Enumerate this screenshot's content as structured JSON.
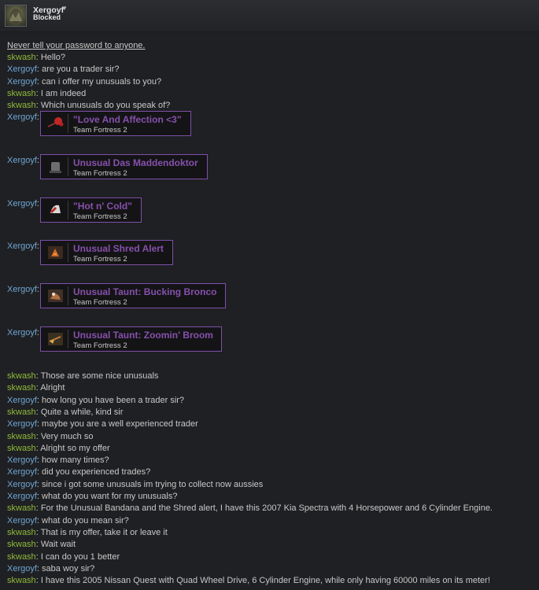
{
  "header": {
    "name": "Xergoyf",
    "status": "Blocked",
    "dropdown_icon": "▼"
  },
  "warning": "Never tell your password to anyone.",
  "accent_colors": {
    "skwash": "#8fb93b",
    "xergoyf": "#6fa6d3",
    "unusual": "#8650ac"
  },
  "messages_top": [
    {
      "sender": "skwash",
      "text": "Hello?"
    },
    {
      "sender": "Xergoyf",
      "text": "are you a trader sir?"
    },
    {
      "sender": "Xergoyf",
      "text": "can i offer my unusuals to you?"
    },
    {
      "sender": "skwash",
      "text": "I am indeed"
    },
    {
      "sender": "skwash",
      "text": "Which unusuals do you speak of?"
    }
  ],
  "items": [
    {
      "sender": "Xergoyf",
      "title": "\"Love And Affection <3\"",
      "game": "Team Fortress 2",
      "icon": "rose-icon"
    },
    {
      "sender": "Xergoyf",
      "title": "Unusual Das Maddendoktor",
      "game": "Team Fortress 2",
      "icon": "hat-icon"
    },
    {
      "sender": "Xergoyf",
      "title": "\"Hot n' Cold\"",
      "game": "Team Fortress 2",
      "icon": "helmet-icon"
    },
    {
      "sender": "Xergoyf",
      "title": "Unusual Shred Alert",
      "game": "Team Fortress 2",
      "icon": "guitar-icon"
    },
    {
      "sender": "Xergoyf",
      "title": "Unusual Taunt: Bucking Bronco",
      "game": "Team Fortress 2",
      "icon": "taunt-icon"
    },
    {
      "sender": "Xergoyf",
      "title": "Unusual Taunt: Zoomin' Broom",
      "game": "Team Fortress 2",
      "icon": "broom-icon"
    }
  ],
  "messages_bottom": [
    {
      "sender": "skwash",
      "text": "Those are some nice unusuals"
    },
    {
      "sender": "skwash",
      "text": "Alright"
    },
    {
      "sender": "Xergoyf",
      "text": "how long you have been a trader sir?"
    },
    {
      "sender": "skwash",
      "text": "Quite a while, kind sir"
    },
    {
      "sender": "Xergoyf",
      "text": "maybe you are a well experienced trader"
    },
    {
      "sender": "skwash",
      "text": "Very much so"
    },
    {
      "sender": "skwash",
      "text": "Alright so my offer"
    },
    {
      "sender": "Xergoyf",
      "text": "how many times?"
    },
    {
      "sender": "Xergoyf",
      "text": "did you experienced trades?"
    },
    {
      "sender": "Xergoyf",
      "text": "since i got some unusuals im trying to collect now aussies"
    },
    {
      "sender": "Xergoyf",
      "text": "what do you want for my unusuals?"
    },
    {
      "sender": "skwash",
      "text": "For the Unusual Bandana and the Shred alert, I have this 2007 Kia Spectra with 4 Horsepower and 6 Cylinder Engine."
    },
    {
      "sender": "Xergoyf",
      "text": "what do you mean sir?"
    },
    {
      "sender": "skwash",
      "text": "That is my offer, take it or leave it"
    },
    {
      "sender": "skwash",
      "text": "Wait wait"
    },
    {
      "sender": "skwash",
      "text": "I can do you 1 better"
    },
    {
      "sender": "Xergoyf",
      "text": "saba woy sir?"
    },
    {
      "sender": "skwash",
      "text": "I have this 2005 Nissan Quest with Quad Wheel Drive, 6 Cylinder Engine, while only having 60000 miles on its meter!"
    }
  ]
}
